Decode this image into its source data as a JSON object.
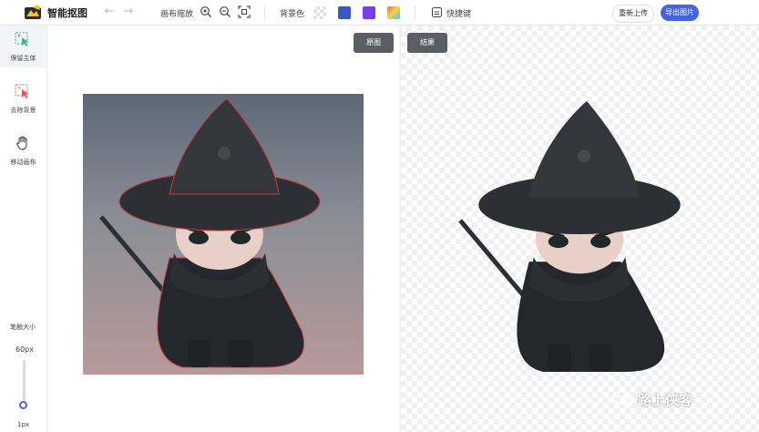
{
  "app": {
    "title": "智能抠图"
  },
  "toolbar": {
    "canvas_zoom_label": "画布缩放",
    "background_color_label": "背景色",
    "shortcuts_label": "快捷键",
    "swatches": [
      "transparent",
      "#3a56c9",
      "#7a3cf2",
      "gradient"
    ],
    "reupload_label": "重新上传",
    "export_label": "导出图片"
  },
  "sidebar": {
    "tools": [
      {
        "label": "保留主体",
        "icon": "keep-subject-icon",
        "active": true
      },
      {
        "label": "去除背景",
        "icon": "remove-background-icon",
        "active": false
      },
      {
        "label": "移动画布",
        "icon": "hand-icon",
        "active": false
      }
    ],
    "brush_size_label": "笔触大小",
    "brush_size_value": "60px",
    "brush_min_label": "1px",
    "brush_size_percent": 5
  },
  "canvas": {
    "original_label": "原图",
    "result_label": "结果"
  },
  "watermark": {
    "text": "路上侠客"
  }
}
